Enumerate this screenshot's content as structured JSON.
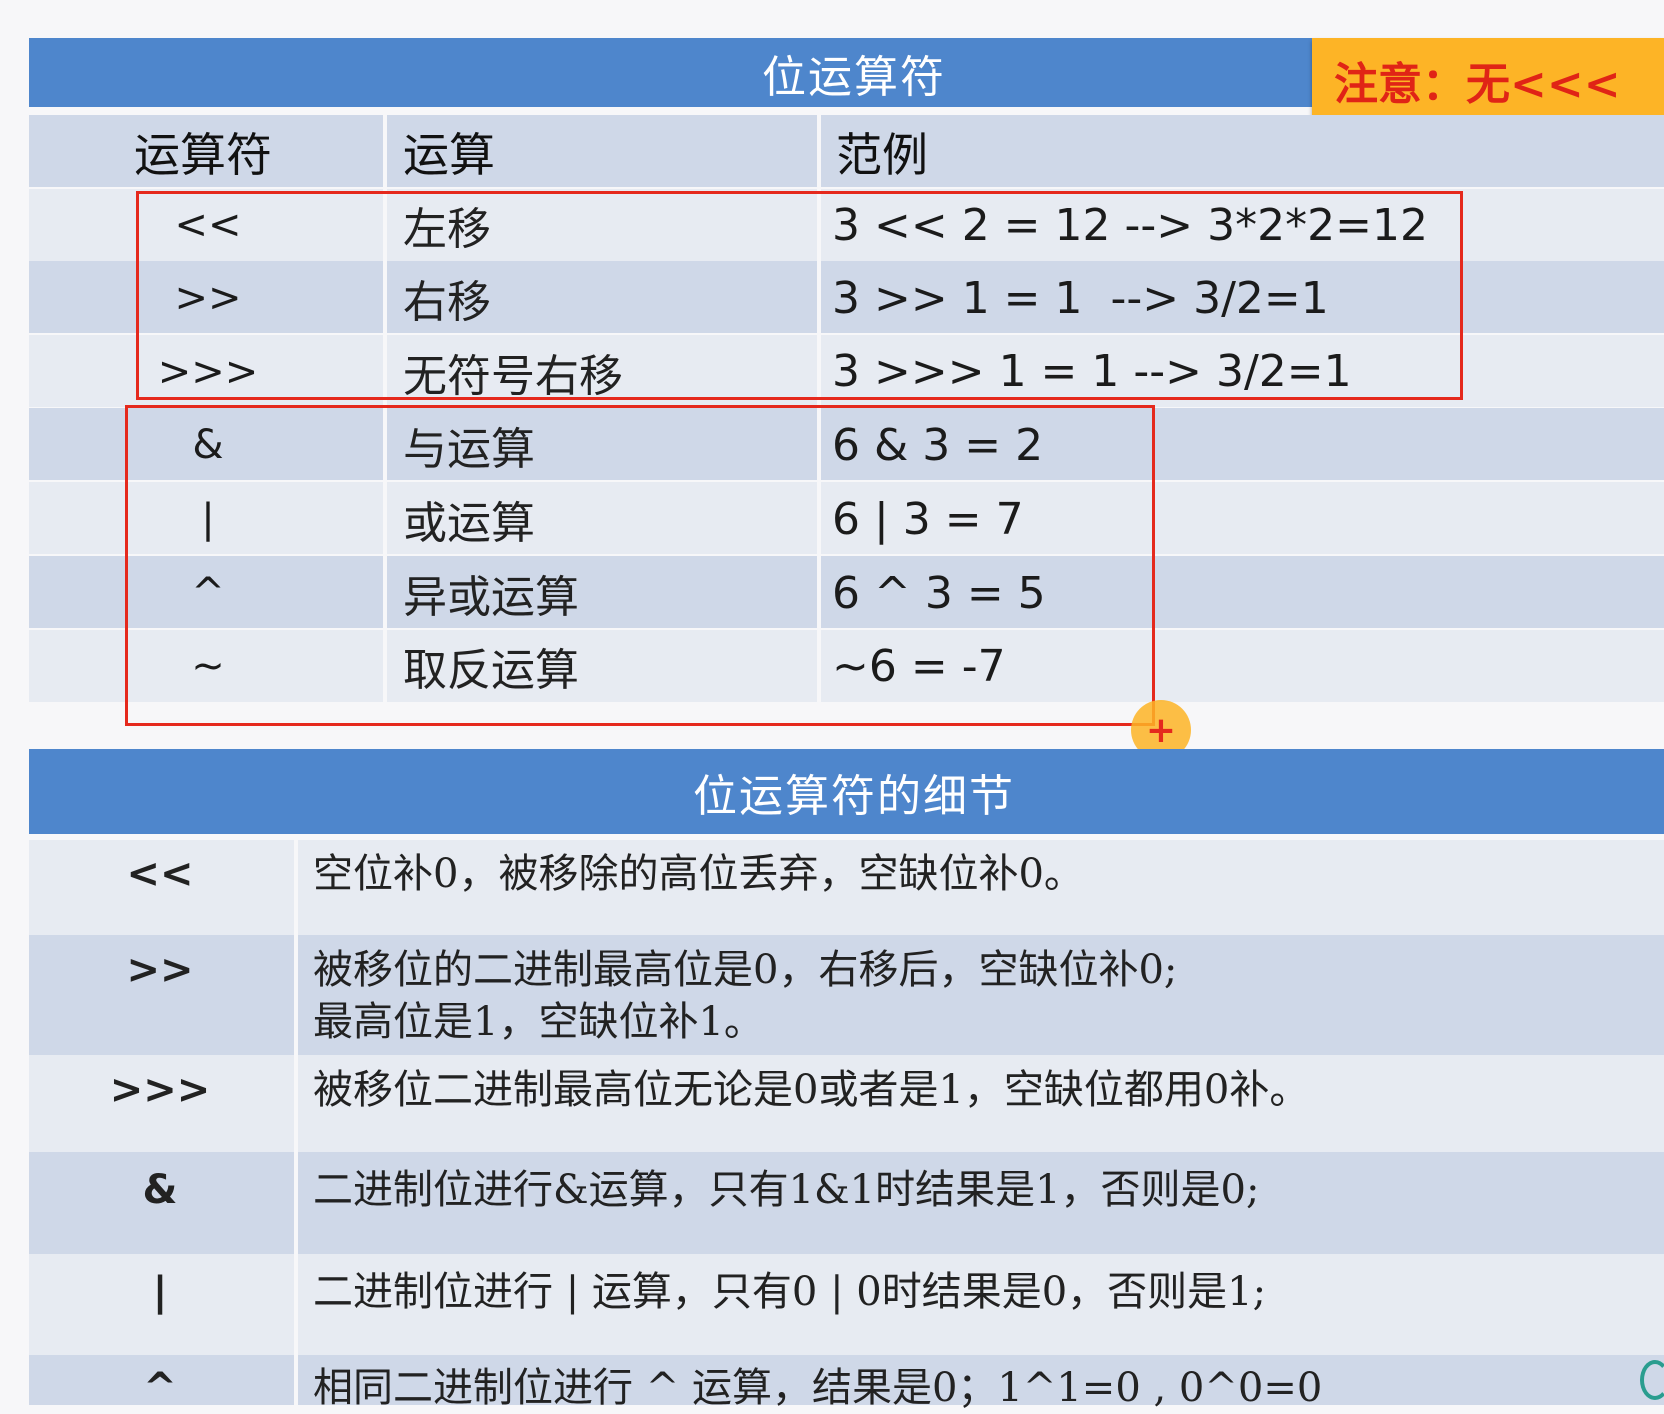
{
  "table1": {
    "title": "位运算符",
    "note": "注意：无<<<",
    "headers": [
      "运算符",
      "运算",
      "范例"
    ],
    "rows": [
      {
        "op": "<<",
        "name": "左移",
        "example": "3 << 2 = 12 --> 3*2*2=12"
      },
      {
        "op": ">>",
        "name": "右移",
        "example": "3 >> 1 = 1  --> 3/2=1"
      },
      {
        "op": ">>>",
        "name": "无符号右移",
        "example": "3 >>> 1 = 1 --> 3/2=1"
      },
      {
        "op": "&",
        "name": "与运算",
        "example": "6 & 3 = 2"
      },
      {
        "op": "|",
        "name": "或运算",
        "example": "6 | 3 = 7"
      },
      {
        "op": "^",
        "name": "异或运算",
        "example": "6 ^ 3 = 5"
      },
      {
        "op": "~",
        "name": "取反运算",
        "example": "~6 = -7"
      }
    ]
  },
  "table2": {
    "title": "位运算符的细节",
    "rows": [
      {
        "op": "<<",
        "desc": "空位补0，被移除的高位丢弃，空缺位补0。"
      },
      {
        "op": ">>",
        "desc": "被移位的二进制最高位是0，右移后，空缺位补0;",
        "desc2": "最高位是1，空缺位补1。"
      },
      {
        "op": ">>>",
        "desc": "被移位二进制最高位无论是0或者是1，空缺位都用0补。"
      },
      {
        "op": "&",
        "desc": "二进制位进行&运算，只有1&1时结果是1，否则是0;"
      },
      {
        "op": "|",
        "desc": "二进制位进行 | 运算，只有0 | 0时结果是0，否则是1;"
      },
      {
        "op": "^",
        "desc": "相同二进制位进行 ^ 运算，结果是0；1^1=0 , 0^0=0"
      }
    ]
  },
  "colors": {
    "header_blue": "#4e86cc",
    "band_dark": "#cfd8e8",
    "band_light": "#e7ebf2",
    "highlight_red": "#e5291d",
    "note_orange": "#fdb426"
  }
}
